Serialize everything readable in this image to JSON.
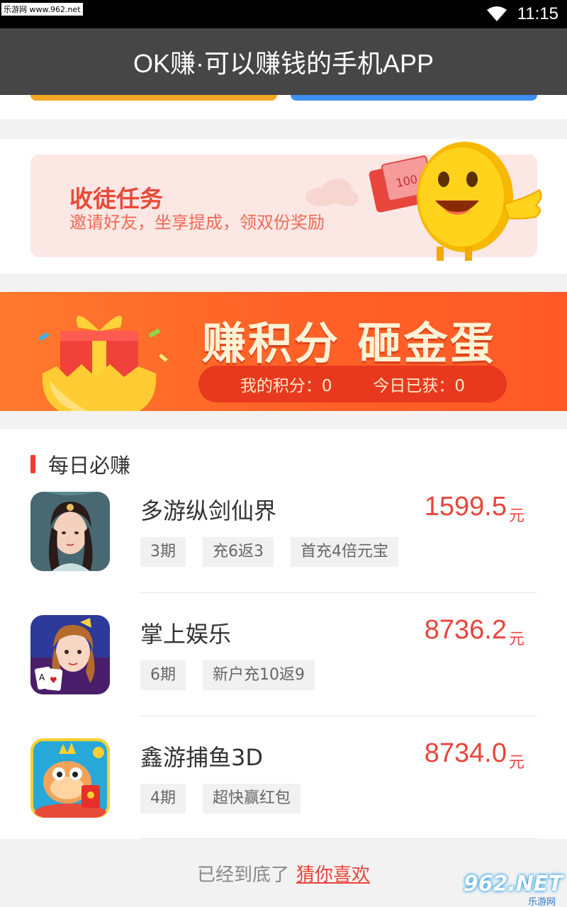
{
  "status_bar": {
    "watermark": "乐游网 www.962.net",
    "time": "11:15"
  },
  "app": {
    "title": "OK赚·可以赚钱的手机APP"
  },
  "recruit": {
    "title": "收徒任务",
    "subtitle": "邀请好友，坐享提成，领双份奖励"
  },
  "egg_banner": {
    "title": "赚积分 砸金蛋",
    "my_points_label": "我的积分：0",
    "today_earned_label": "今日已获：0"
  },
  "daily": {
    "title": "每日必赚",
    "games": [
      {
        "name": "多游纵剑仙界",
        "price": "1599.5",
        "unit": "元",
        "tags": [
          "3期",
          "充6返3",
          "首充4倍元宝"
        ]
      },
      {
        "name": "掌上娱乐",
        "price": "8736.2",
        "unit": "元",
        "tags": [
          "6期",
          "新户充10返9"
        ]
      },
      {
        "name": "鑫游捕鱼3D",
        "price": "8734.0",
        "unit": "元",
        "tags": [
          "4期",
          "超快赢红包"
        ]
      }
    ]
  },
  "footer": {
    "end_text": "已经到底了",
    "guess_link": "猜你喜欢"
  },
  "watermark_bottom": {
    "brand": "962.NET",
    "sub": "乐游网"
  },
  "colors": {
    "accent": "#e8453c",
    "title_bar": "#464646",
    "banner": "#ff6227"
  }
}
